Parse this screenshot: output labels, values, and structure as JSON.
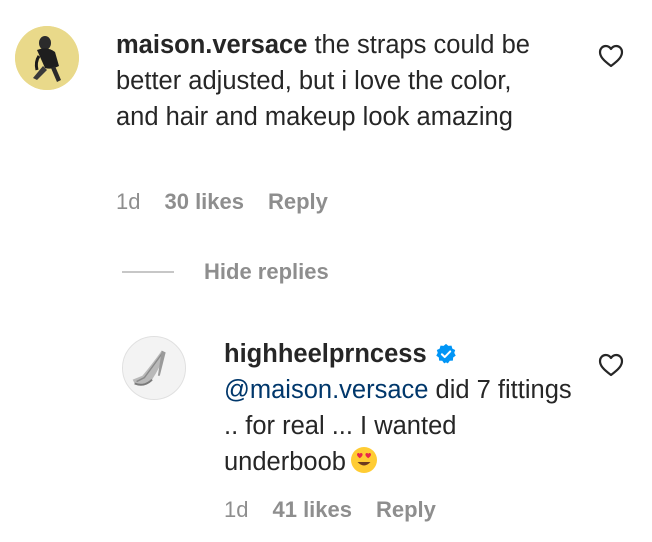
{
  "comments": [
    {
      "username": "maison.versace",
      "text": " the straps could be better adjusted, but i love the color, and hair and makeup look amazing",
      "time": "1d",
      "likes": "30 likes",
      "reply": "Reply",
      "avatar_bg": "#e9d98a"
    },
    {
      "username": "highheelprncess",
      "verified": true,
      "mention": "@maison.versace",
      "text": " did 7 fittings .. for real ... I wanted underboob",
      "emoji": "heart-eyes-emoji",
      "time": "1d",
      "likes": "41 likes",
      "reply": "Reply",
      "avatar_bg": "#f2f2f2"
    }
  ],
  "hide_replies": "Hide replies",
  "colors": {
    "text": "#262626",
    "secondary": "#8e8e8e",
    "mention": "#00376b",
    "verified": "#0095f6"
  }
}
